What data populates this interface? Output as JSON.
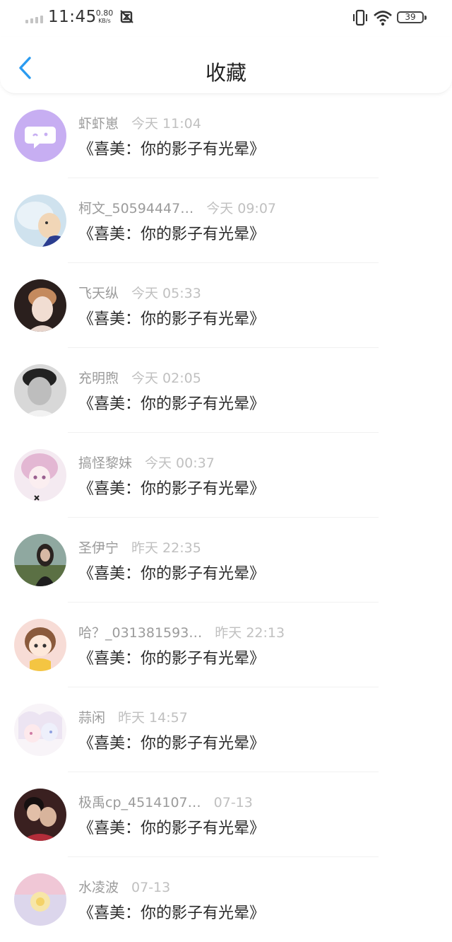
{
  "status_bar": {
    "time": "11:45",
    "net_speed_value": "0.80",
    "net_speed_unit": "KB/s",
    "battery": "39",
    "icons": [
      "signal-icon",
      "no-notification-icon",
      "vibrate-icon",
      "wifi-icon",
      "battery-icon"
    ]
  },
  "nav": {
    "title": "收藏",
    "back_icon": "chevron-left-icon",
    "accent_color": "#2a9bf0"
  },
  "favorites": [
    {
      "user": "虾虾崽",
      "time": "今天 11:04",
      "content": "《喜美：你的影子有光晕》"
    },
    {
      "user": "柯文_50594447…",
      "time": "今天 09:07",
      "content": "《喜美：你的影子有光晕》"
    },
    {
      "user": "飞天纵",
      "time": "今天 05:33",
      "content": "《喜美：你的影子有光晕》"
    },
    {
      "user": "充明煦",
      "time": "今天 02:05",
      "content": "《喜美：你的影子有光晕》"
    },
    {
      "user": "搞怪黎妹",
      "time": "今天 00:37",
      "content": "《喜美：你的影子有光晕》"
    },
    {
      "user": "圣伊宁",
      "time": "昨天 22:35",
      "content": "《喜美：你的影子有光晕》"
    },
    {
      "user": "哈？_031381593…",
      "time": "昨天 22:13",
      "content": "《喜美：你的影子有光晕》"
    },
    {
      "user": "蒜闲",
      "time": "昨天 14:57",
      "content": "《喜美：你的影子有光晕》"
    },
    {
      "user": "极禹cp_4514107…",
      "time": "07-13",
      "content": "《喜美：你的影子有光晕》"
    },
    {
      "user": "水凌波",
      "time": "07-13",
      "content": "《喜美：你的影子有光晕》"
    }
  ]
}
